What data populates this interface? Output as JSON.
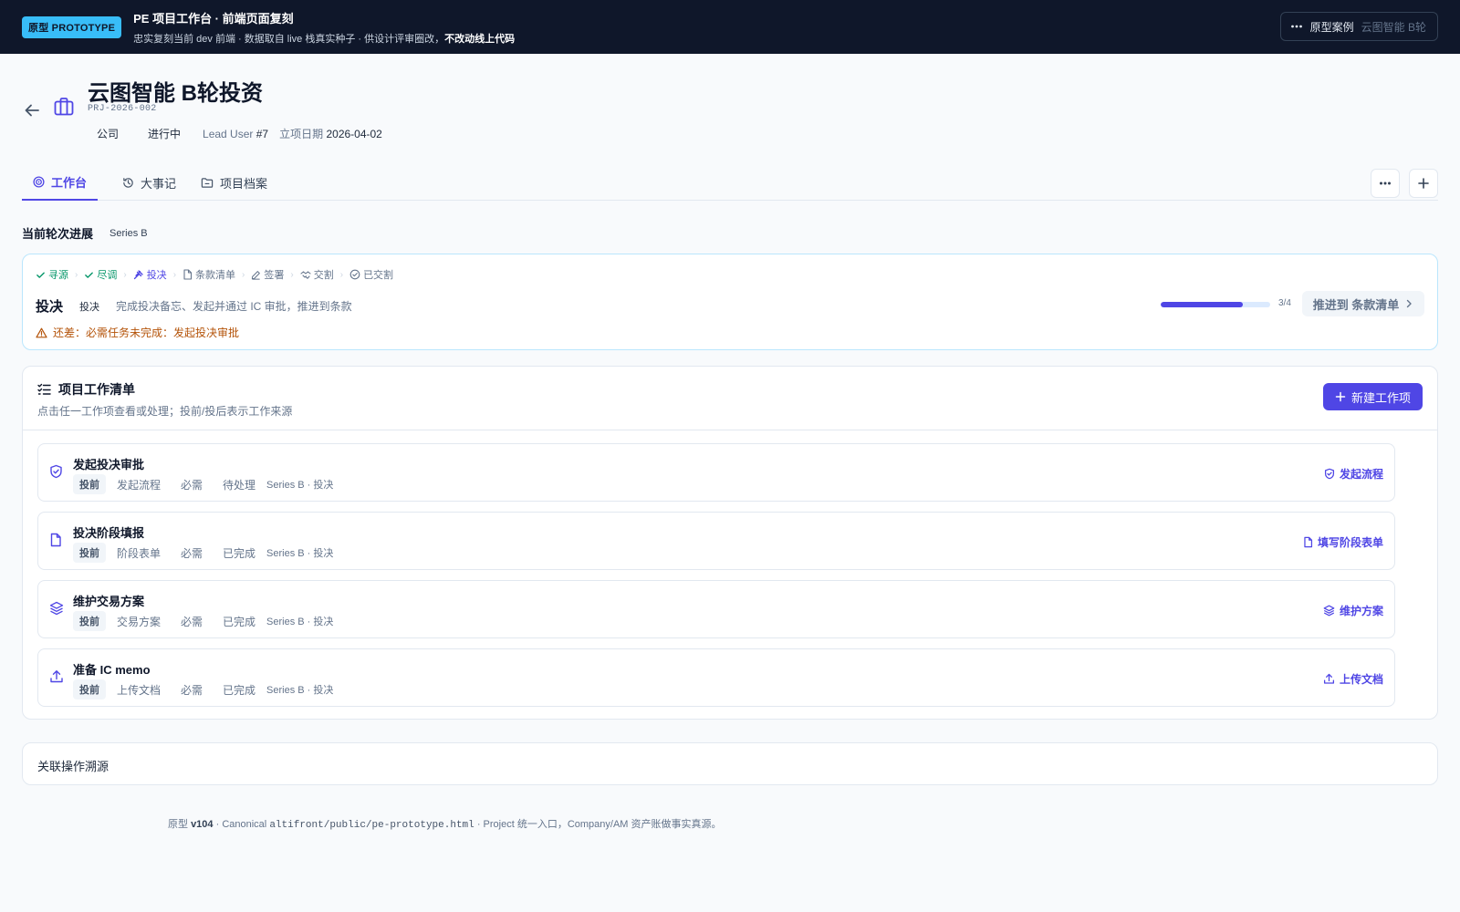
{
  "banner": {
    "badge": "原型 PROTOTYPE",
    "title": "PE 项目工作台 · 前端页面复刻",
    "subtitle": "忠实复刻当前 dev 前端 · 数据取自 live 栈真实种子 · 供设计评审圈改，",
    "subtitle_bold": "不改动线上代码",
    "case_label": "原型案例",
    "case_value": "云图智能 B轮"
  },
  "project": {
    "title": "云图智能 B轮投资",
    "code": "PRJ-2026-002",
    "type": "公司",
    "status": "进行中",
    "lead_label": "Lead User",
    "lead_value": "#7",
    "date_label": "立项日期",
    "date_value": "2026-04-02"
  },
  "tabs": [
    {
      "label": "工作台",
      "icon": "target-icon"
    },
    {
      "label": "大事记",
      "icon": "history-icon"
    },
    {
      "label": "项目档案",
      "icon": "folder-icon"
    }
  ],
  "round": {
    "title": "当前轮次进展",
    "name": "Series B",
    "stages": [
      {
        "label": "寻源",
        "state": "done"
      },
      {
        "label": "尽调",
        "state": "done"
      },
      {
        "label": "投决",
        "state": "current"
      },
      {
        "label": "条款清单",
        "state": "pending"
      },
      {
        "label": "签署",
        "state": "pending"
      },
      {
        "label": "交割",
        "state": "pending"
      },
      {
        "label": "已交割",
        "state": "pending"
      }
    ],
    "current_stage": "投决",
    "current_tag": "投决",
    "current_desc": "完成投决备忘、发起并通过 IC 审批，推进到条款",
    "progress_done": 3,
    "progress_total": 4,
    "progress_label": "3/4",
    "advance_label": "推进到 条款清单",
    "warning": "还差：必需任务未完成：发起投决审批"
  },
  "worklist": {
    "title": "项目工作清单",
    "subtitle": "点击任一工作项查看或处理；投前/投后表示工作来源",
    "new_label": "新建工作项",
    "items": [
      {
        "name": "发起投决审批",
        "source": "投前",
        "kind": "发起流程",
        "required": "必需",
        "status": "待处理",
        "round": "Series B · 投决",
        "action": "发起流程",
        "icon": "shield-check-icon"
      },
      {
        "name": "投决阶段填报",
        "source": "投前",
        "kind": "阶段表单",
        "required": "必需",
        "status": "已完成",
        "round": "Series B · 投决",
        "action": "填写阶段表单",
        "icon": "file-icon"
      },
      {
        "name": "维护交易方案",
        "source": "投前",
        "kind": "交易方案",
        "required": "必需",
        "status": "已完成",
        "round": "Series B · 投决",
        "action": "维护方案",
        "icon": "layers-icon"
      },
      {
        "name": "准备 IC memo",
        "source": "投前",
        "kind": "上传文档",
        "required": "必需",
        "status": "已完成",
        "round": "Series B · 投决",
        "action": "上传文档",
        "icon": "upload-icon"
      }
    ]
  },
  "trace": {
    "title": "关联操作溯源"
  },
  "footer": {
    "prefix": "原型",
    "version": "v104",
    "canonical_label": "· Canonical",
    "path": "altifront/public/pe-prototype.html",
    "suffix": "· Project 统一入口，Company/AM 资产账做事实真源。"
  },
  "colors": {
    "accent": "#4f46e5",
    "done": "#059669",
    "warning": "#b45309",
    "banner_bg": "#0f172a",
    "badge": "#38bdf8"
  }
}
